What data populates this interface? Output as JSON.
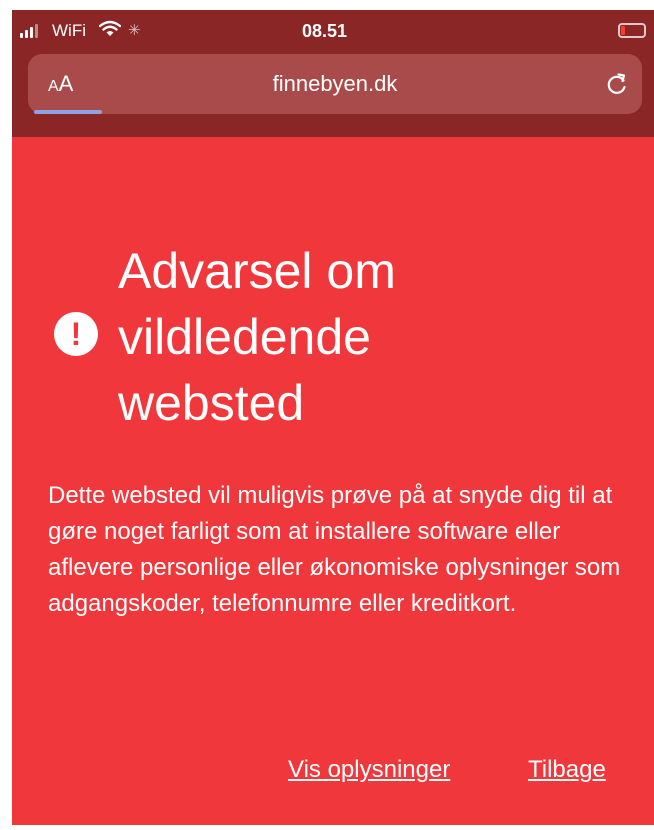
{
  "status_bar": {
    "carrier": "WiFi",
    "time": "08.51",
    "icons": [
      "signal-icon",
      "wifi-icon",
      "activity-spinner-icon",
      "battery-icon"
    ]
  },
  "address_bar": {
    "text_size_label": "AA",
    "url": "finnebyen.dk",
    "reload_icon": "reload-icon"
  },
  "warning": {
    "icon": "exclamation-circle-icon",
    "title": "Advarsel om vildledende websted",
    "body": "Dette websted vil muligvis prøve på at snyde dig til at gøre noget farligt som at installere software eller aflevere personlige eller økonomiske oplysninger som adgangskoder, telefonnumre eller kreditkort."
  },
  "actions": {
    "details_label": "Vis oplysninger",
    "back_label": "Tilbage"
  },
  "colors": {
    "warning_background": "#f0373c",
    "chrome_background": "#8a2626",
    "address_bar_background": "#a94b4b",
    "text": "#ffffff"
  }
}
